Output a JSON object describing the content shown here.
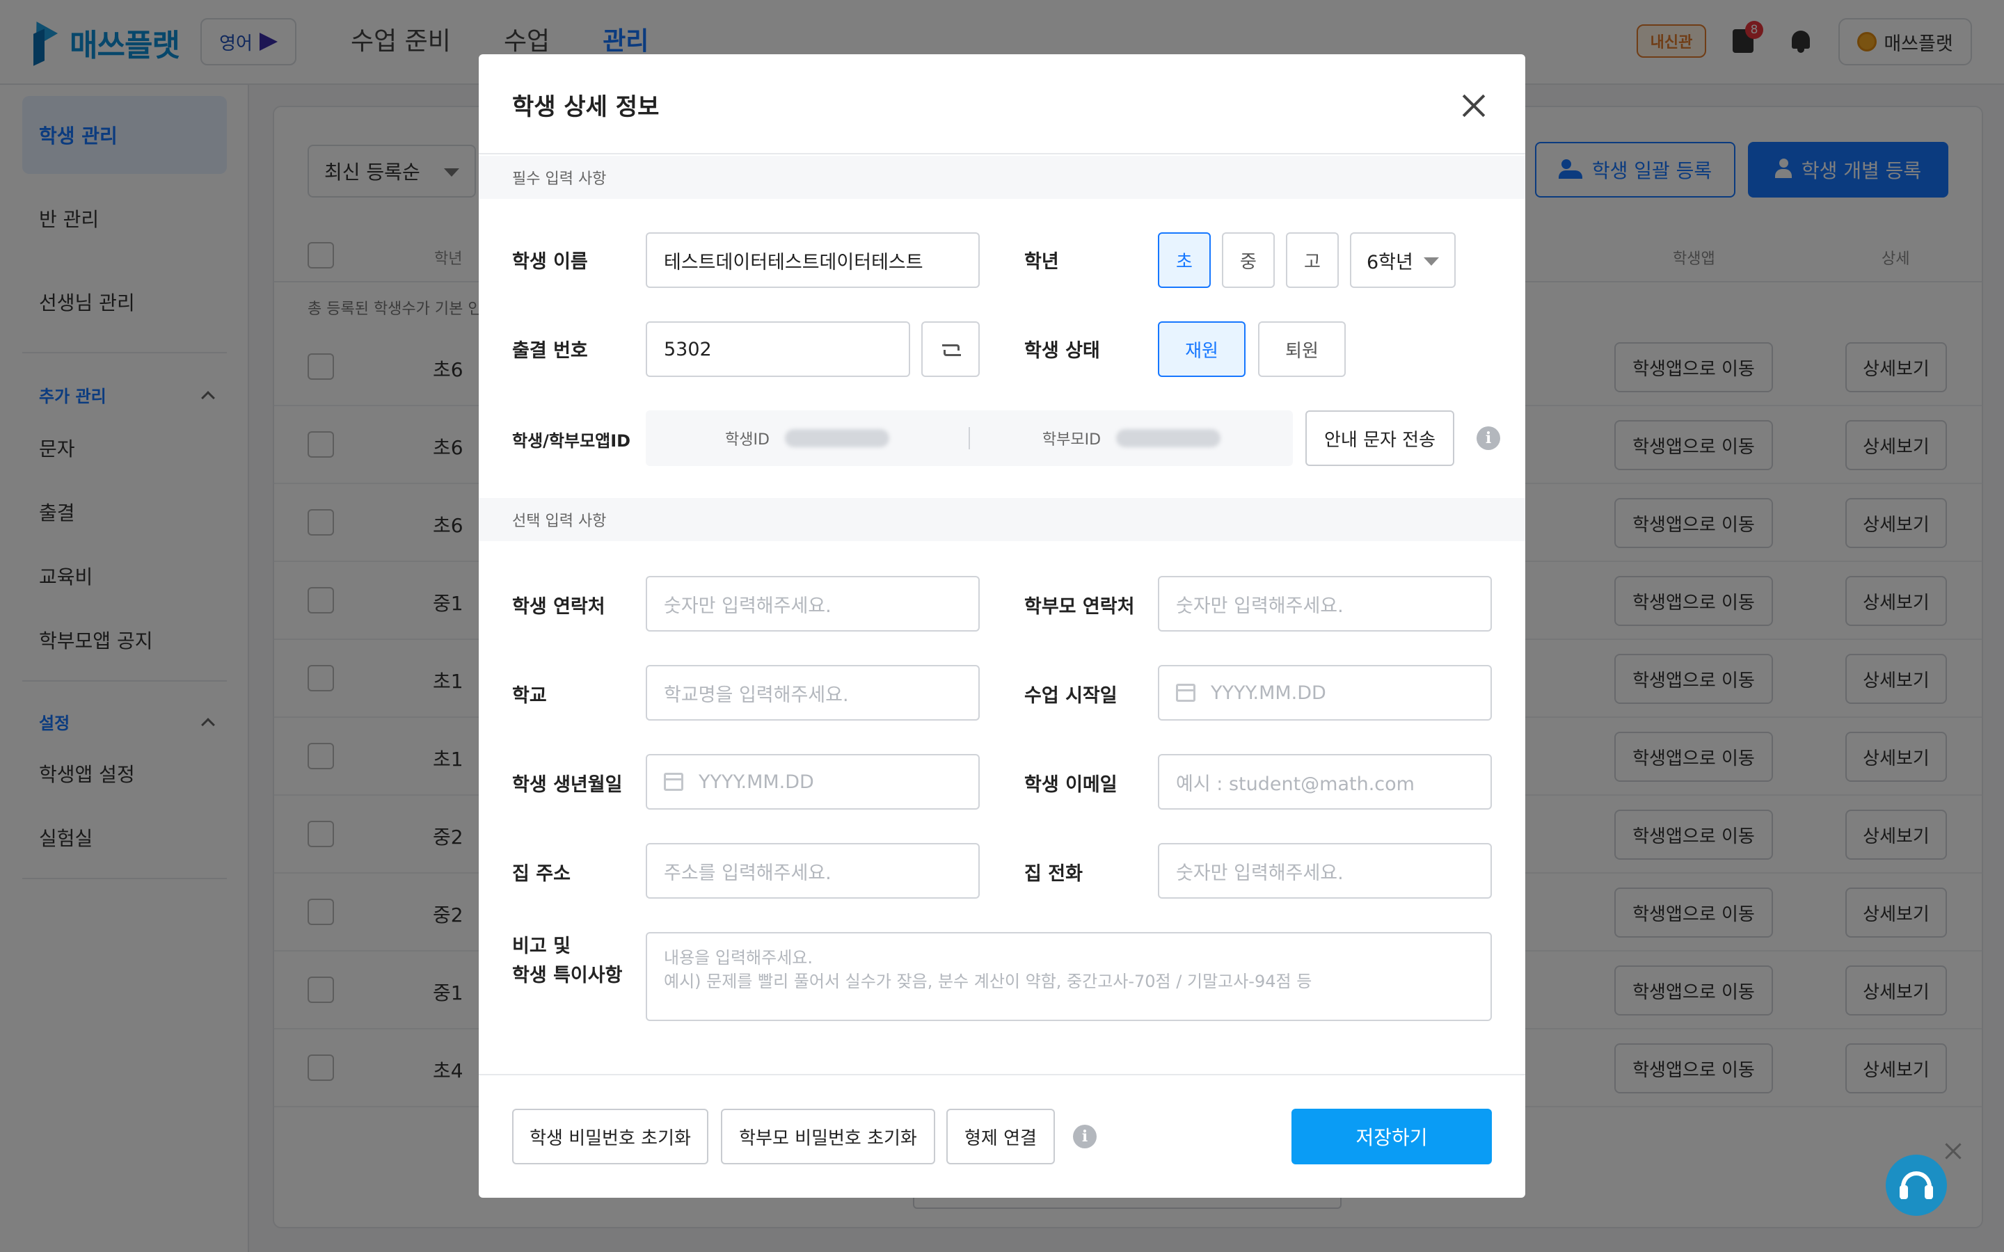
{
  "header": {
    "logo_text": "매쓰플랫",
    "language": "영어",
    "nav": [
      "수업 준비",
      "수업",
      "관리"
    ],
    "active_nav": "관리",
    "naesin_badge": "내신관",
    "clip_badge_count": "8",
    "user_name": "매쓰플랫"
  },
  "sidebar": {
    "items": [
      "학생 관리",
      "반 관리",
      "선생님 관리"
    ],
    "section_extra": "추가 관리",
    "extra_items": [
      "문자",
      "출결",
      "교육비",
      "학부모앱 공지"
    ],
    "section_settings": "설정",
    "settings_items": [
      "학생앱 설정",
      "실험실"
    ]
  },
  "main": {
    "sort_label": "최신 등록순",
    "bulk_register": "학생 일괄 등록",
    "single_register": "학생 개별 등록",
    "col_grade": "학년",
    "col_app": "학생앱",
    "col_detail": "상세",
    "info_text": "총 등록된 학생수가 기본 인",
    "rows": [
      {
        "grade": "초6",
        "app_btn": "학생앱으로 이동",
        "detail_btn": "상세보기"
      },
      {
        "grade": "초6",
        "app_btn": "학생앱으로 이동",
        "detail_btn": "상세보기"
      },
      {
        "grade": "초6",
        "app_btn": "학생앱으로 이동",
        "detail_btn": "상세보기"
      },
      {
        "grade": "중1",
        "app_btn": "학생앱으로 이동",
        "detail_btn": "상세보기"
      },
      {
        "grade": "초1",
        "app_btn": "학생앱으로 이동",
        "detail_btn": "상세보기"
      },
      {
        "grade": "초1",
        "app_btn": "학생앱으로 이동",
        "detail_btn": "상세보기"
      },
      {
        "grade": "중2",
        "app_btn": "학생앱으로 이동",
        "detail_btn": "상세보기"
      },
      {
        "grade": "중2",
        "app_btn": "학생앱으로 이동",
        "detail_btn": "상세보기"
      },
      {
        "grade": "중1",
        "app_btn": "학생앱으로 이동",
        "detail_btn": "상세보기"
      },
      {
        "grade": "초4",
        "app_btn": "학생앱으로 이동",
        "detail_btn": "상세보기"
      }
    ]
  },
  "modal": {
    "title": "학생 상세 정보",
    "required_section": "필수 입력 사항",
    "optional_section": "선택 입력 사항",
    "name_label": "학생 이름",
    "name_value": "테스트데이터테스트데이터테스트",
    "grade_label": "학년",
    "school_levels": [
      "초",
      "중",
      "고"
    ],
    "selected_level": "초",
    "grade_value": "6학년",
    "attendance_label": "출결 번호",
    "attendance_value": "5302",
    "status_label": "학생 상태",
    "status_options": [
      "재원",
      "퇴원"
    ],
    "selected_status": "재원",
    "appid_label": "학생/학부모앱ID",
    "student_id_label": "학생ID",
    "parent_id_label": "학부모ID",
    "send_guide_btn": "안내 문자 전송",
    "student_phone_label": "학생 연락처",
    "student_phone_ph": "숫자만 입력해주세요.",
    "parent_phone_label": "학부모 연락처",
    "parent_phone_ph": "숫자만 입력해주세요.",
    "school_label": "학교",
    "school_ph": "학교명을 입력해주세요.",
    "class_start_label": "수업 시작일",
    "class_start_ph": "YYYY.MM.DD",
    "birth_label": "학생 생년월일",
    "birth_ph": "YYYY.MM.DD",
    "email_label": "학생 이메일",
    "email_ph": "예시 : student@math.com",
    "address_label": "집 주소",
    "address_ph": "주소를 입력해주세요.",
    "home_phone_label": "집 전화",
    "home_phone_ph": "숫자만 입력해주세요.",
    "note_label_1": "비고 및",
    "note_label_2": "학생 특이사항",
    "note_ph_1": "내용을 입력해주세요.",
    "note_ph_2": "예시) 문제를 빨리 풀어서 실수가 잦음, 분수 계산이 약함, 중간고사-70점 / 기말고사-94점 등",
    "reset_student_pw": "학생 비밀번호 초기화",
    "reset_parent_pw": "학부모 비밀번호 초기화",
    "sibling_link": "형제 연결",
    "save": "저장하기"
  },
  "colors": {
    "primary": "#1677ff",
    "save": "#0a9cf5",
    "badge_red": "#e8343b",
    "naesin": "#e07b2c"
  }
}
